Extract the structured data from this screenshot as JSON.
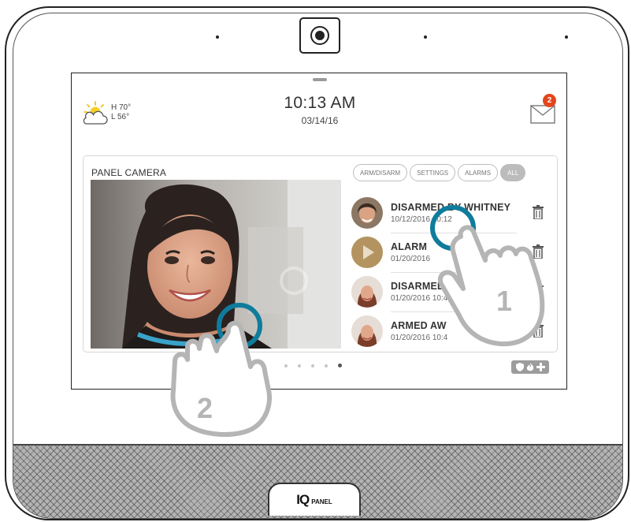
{
  "device": {
    "brand_logo": "IQ",
    "brand_sub": "PANEL"
  },
  "status_bar": {
    "weather": {
      "icon": "partly-cloudy-icon",
      "high": "H 70°",
      "low": "L 56°"
    },
    "time": "10:13 AM",
    "date": "03/14/16",
    "messages": {
      "icon": "envelope-icon",
      "unread_count": "2"
    }
  },
  "panel_camera": {
    "title": "PANEL CAMERA",
    "filters": [
      {
        "label": "ARM/DISARM",
        "active": false
      },
      {
        "label": "SETTINGS",
        "active": false
      },
      {
        "label": "ALARMS",
        "active": false
      },
      {
        "label": "ALL",
        "active": true
      }
    ],
    "events": [
      {
        "title": "DISARMED BY WHITNEY",
        "time": "10/12/2016 10:12"
      },
      {
        "title": "ALARM",
        "time": "01/20/2016"
      },
      {
        "title": "DISARMED BY",
        "time": "01/20/2016 10:4"
      },
      {
        "title": "ARMED AW",
        "time": "01/20/2016 10:4"
      }
    ]
  },
  "pager": {
    "pages": 5,
    "current": 5
  },
  "quick_actions": {
    "icons": [
      "shield-icon",
      "flame-icon",
      "plus-icon"
    ]
  },
  "tutorial_gestures": [
    {
      "step": "1"
    },
    {
      "step": "2"
    }
  ],
  "colors": {
    "badge": "#e4451c",
    "tap_ring": "#0f7c9c",
    "hand": "#b5b5b5",
    "active_filter": "#bcbcbc"
  }
}
